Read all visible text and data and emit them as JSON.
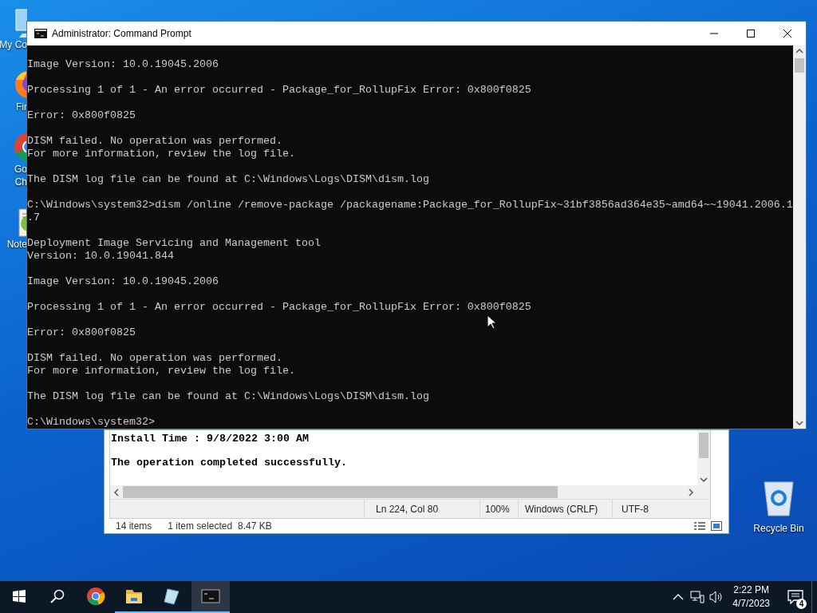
{
  "desktop_icons": [
    {
      "kind": "computer",
      "lines": [
        "My Co"
      ]
    },
    {
      "kind": "firefox",
      "lines": [
        "Fir"
      ]
    },
    {
      "kind": "chrome",
      "lines": [
        "Go",
        "Ch"
      ]
    },
    {
      "kind": "notepad",
      "lines": [
        "Note"
      ]
    }
  ],
  "recycle_bin": {
    "label": "Recycle Bin"
  },
  "explorer": {
    "item_count": "14 items",
    "selection": "1 item selected",
    "size": "8.47 KB"
  },
  "notepad": {
    "blocks": [
      [
        "Install Time : 9/8/2022 3:00 AM"
      ],
      [
        "The operation completed successfully."
      ]
    ],
    "status": {
      "position": "Ln 224, Col 80",
      "zoom": "100%",
      "line_ending": "Windows (CRLF)",
      "encoding": "UTF-8"
    }
  },
  "console": {
    "title": "Administrator:  Command Prompt",
    "blocks": [
      [
        "Image Version: 10.0.19045.2006"
      ],
      [
        "Processing 1 of 1 - An error occurred - Package_for_RollupFix Error: 0x800f0825"
      ],
      [
        "Error: 0x800f0825"
      ],
      [
        "DISM failed. No operation was performed.",
        "For more information, review the log file."
      ],
      [
        "The DISM log file can be found at C:\\Windows\\Logs\\DISM\\dism.log"
      ],
      [
        "C:\\Windows\\system32>dism /online /remove-package /packagename:Package_for_RollupFix~31bf3856ad364e35~amd64~~19041.2006.1",
        ".7"
      ],
      [
        "Deployment Image Servicing and Management tool",
        "Version: 10.0.19041.844"
      ],
      [
        "Image Version: 10.0.19045.2006"
      ],
      [
        "Processing 1 of 1 - An error occurred - Package_for_RollupFix Error: 0x800f0825"
      ],
      [
        "Error: 0x800f0825"
      ],
      [
        "DISM failed. No operation was performed.",
        "For more information, review the log file."
      ],
      [
        "The DISM log file can be found at C:\\Windows\\Logs\\DISM\\dism.log"
      ],
      [
        "C:\\Windows\\system32>"
      ]
    ]
  },
  "taskbar": {
    "apps": [
      {
        "kind": "chrome",
        "running": false,
        "active": false
      },
      {
        "kind": "folder",
        "running": true,
        "active": false
      },
      {
        "kind": "notepad",
        "running": true,
        "active": false
      },
      {
        "kind": "console",
        "running": true,
        "active": true
      }
    ],
    "clock": {
      "time": "2:22 PM",
      "date": "4/7/2023"
    },
    "notification_count": "4"
  }
}
